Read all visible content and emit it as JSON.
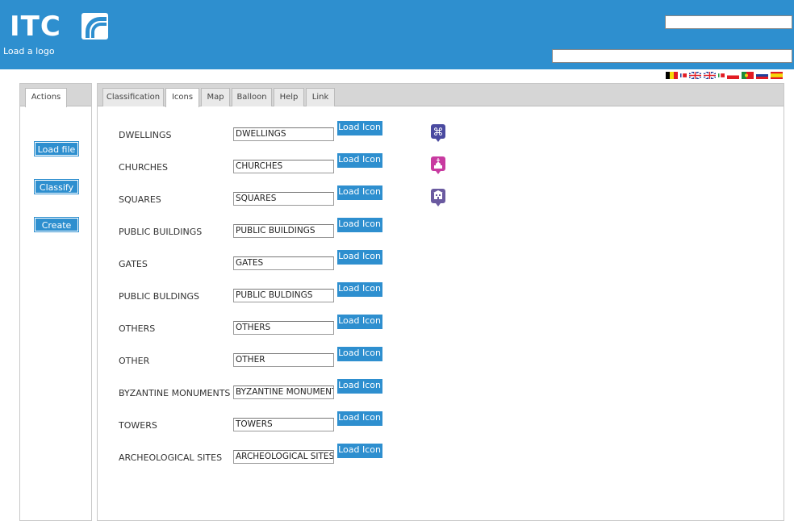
{
  "header": {
    "logo_text": "ITC",
    "load_logo_label": "Load a logo",
    "search_value_1": "",
    "search_value_2": ""
  },
  "flags": [
    {
      "name": "belgium-flag",
      "colors": [
        "#000000",
        "#f5d90a",
        "#e21b23"
      ]
    },
    {
      "name": "france-flag",
      "colors": [
        "#1f3f9a",
        "#ffffff",
        "#e21b23"
      ]
    },
    {
      "name": "uk-flag",
      "colors": [
        "#1f3f9a",
        "#ffffff",
        "#e21b23"
      ]
    },
    {
      "name": "uk-flag-2",
      "colors": [
        "#1f3f9a",
        "#ffffff",
        "#e21b23"
      ]
    },
    {
      "name": "italy-flag",
      "colors": [
        "#1e9a3c",
        "#ffffff",
        "#e21b23"
      ]
    },
    {
      "name": "poland-flag",
      "colors": [
        "#ffffff",
        "#e21b23"
      ]
    },
    {
      "name": "portugal-flag",
      "colors": [
        "#1e8a3c",
        "#e21b23"
      ]
    },
    {
      "name": "slovenia-flag",
      "colors": [
        "#ffffff",
        "#1f3f9a",
        "#e21b23"
      ]
    },
    {
      "name": "spain-flag",
      "colors": [
        "#e21b23",
        "#f5d90a",
        "#e21b23"
      ]
    }
  ],
  "left_panel": {
    "tab_label": "Actions",
    "buttons": [
      "Load file",
      "Classify",
      "Create"
    ]
  },
  "main_panel": {
    "tabs": [
      "Classification",
      "Icons",
      "Map",
      "Balloon",
      "Help",
      "Link"
    ],
    "active_tab": "Icons",
    "rows": [
      {
        "label": "DWELLINGS",
        "value": "DWELLINGS",
        "button": "Load Icon"
      },
      {
        "label": "CHURCHES",
        "value": "CHURCHES",
        "button": "Load Icon"
      },
      {
        "label": "SQUARES",
        "value": "SQUARES",
        "button": "Load Icon"
      },
      {
        "label": "PUBLIC BUILDINGS",
        "value": "PUBLIC BUILDINGS",
        "button": "Load Icon"
      },
      {
        "label": "GATES",
        "value": "GATES",
        "button": "Load Icon"
      },
      {
        "label": "PUBLIC BULDINGS",
        "value": "PUBLIC BULDINGS",
        "button": "Load Icon"
      },
      {
        "label": "OTHERS",
        "value": "OTHERS",
        "button": "Load Icon"
      },
      {
        "label": "OTHER",
        "value": "OTHER",
        "button": "Load Icon"
      },
      {
        "label": "BYZANTINE MONUMENTS",
        "value": "BYZANTINE MONUMENTS",
        "button": "Load Icon"
      },
      {
        "label": "TOWERS",
        "value": "TOWERS",
        "button": "Load Icon"
      },
      {
        "label": "ARCHEOLOGICAL SITES",
        "value": "ARCHEOLOGICAL SITES",
        "button": "Load Icon"
      }
    ],
    "markers": [
      {
        "name": "command-marker-icon",
        "color": "#4a4aa0"
      },
      {
        "name": "church-marker-icon",
        "color": "#c83aa0"
      },
      {
        "name": "square-marker-icon",
        "color": "#6a5aa0"
      }
    ]
  },
  "colors": {
    "accent": "#2e8fcf",
    "tabbar": "#d6d6d6"
  }
}
